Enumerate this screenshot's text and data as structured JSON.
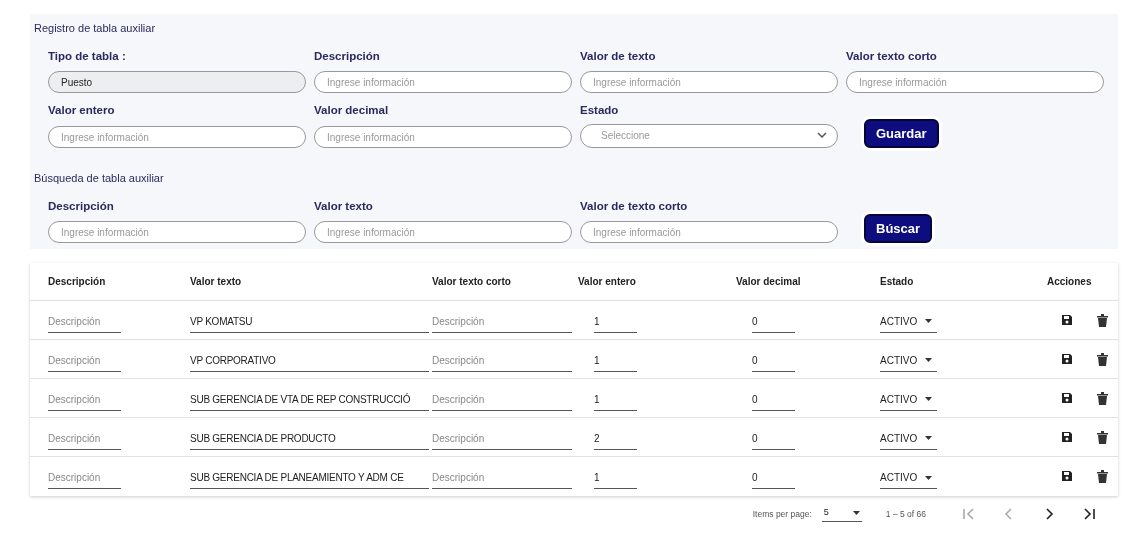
{
  "registro": {
    "title": "Registro de tabla auxiliar",
    "fields": [
      {
        "kind": "text",
        "label": "Tipo de tabla :",
        "value": "Puesto",
        "disabled": true
      },
      {
        "kind": "text",
        "label": "Descripción",
        "placeholder": "Ingrese información",
        "disabled": false
      },
      {
        "kind": "text",
        "label": "Valor de texto",
        "placeholder": "Ingrese información",
        "disabled": false
      },
      {
        "kind": "text",
        "label": "Valor texto corto",
        "placeholder": "Ingrese información",
        "disabled": false
      },
      {
        "kind": "text",
        "label": "Valor entero",
        "placeholder": "Ingrese información",
        "disabled": false
      },
      {
        "kind": "text",
        "label": "Valor decimal",
        "placeholder": "Ingrese información",
        "disabled": false
      },
      {
        "kind": "select",
        "label": "Estado",
        "placeholder": "Seleccione",
        "disabled": false
      }
    ],
    "button": "Guardar"
  },
  "busqueda": {
    "title": "Búsqueda de tabla auxiliar",
    "fields": [
      {
        "kind": "text",
        "label": "Descripción",
        "placeholder": "Ingrese información",
        "disabled": false
      },
      {
        "kind": "text",
        "label": "Valor texto",
        "placeholder": "Ingrese información",
        "disabled": false
      },
      {
        "kind": "text",
        "label": "Valor de texto corto",
        "placeholder": "Ingrese información",
        "disabled": false
      }
    ],
    "button": "Búscar"
  },
  "table": {
    "columns": [
      "Descripción",
      "Valor texto",
      "Valor texto corto",
      "Valor entero",
      "Valor decimal",
      "Estado",
      "Acciones"
    ],
    "rows": [
      {
        "descripcion": "Descripción",
        "valor_texto": "VP KOMATSU",
        "valor_texto_corto": "Descripción",
        "valor_entero": "1",
        "valor_decimal": "0",
        "estado": "ACTIVO"
      },
      {
        "descripcion": "Descripción",
        "valor_texto": "VP CORPORATIVO",
        "valor_texto_corto": "Descripción",
        "valor_entero": "1",
        "valor_decimal": "0",
        "estado": "ACTIVO"
      },
      {
        "descripcion": "Descripción",
        "valor_texto": "SUB GERENCIA DE VTA DE REP CONSTRUCCIÓ",
        "valor_texto_corto": "Descripción",
        "valor_entero": "1",
        "valor_decimal": "0",
        "estado": "ACTIVO"
      },
      {
        "descripcion": "Descripción",
        "valor_texto": "SUB GERENCIA DE PRODUCTO",
        "valor_texto_corto": "Descripción",
        "valor_entero": "2",
        "valor_decimal": "0",
        "estado": "ACTIVO"
      },
      {
        "descripcion": "Descripción",
        "valor_texto": "SUB GERENCIA DE PLANEAMIENTO Y ADM CE",
        "valor_texto_corto": "Descripción",
        "valor_entero": "1",
        "valor_decimal": "0",
        "estado": "ACTIVO"
      }
    ]
  },
  "paginator": {
    "items_per_page_label": "Items per page:",
    "page_size": "5",
    "range": "1 – 5 of 66",
    "buttons": [
      {
        "kind": "first",
        "disabled": true
      },
      {
        "kind": "prev",
        "disabled": true
      },
      {
        "kind": "next",
        "disabled": false
      },
      {
        "kind": "last",
        "disabled": false
      }
    ]
  }
}
